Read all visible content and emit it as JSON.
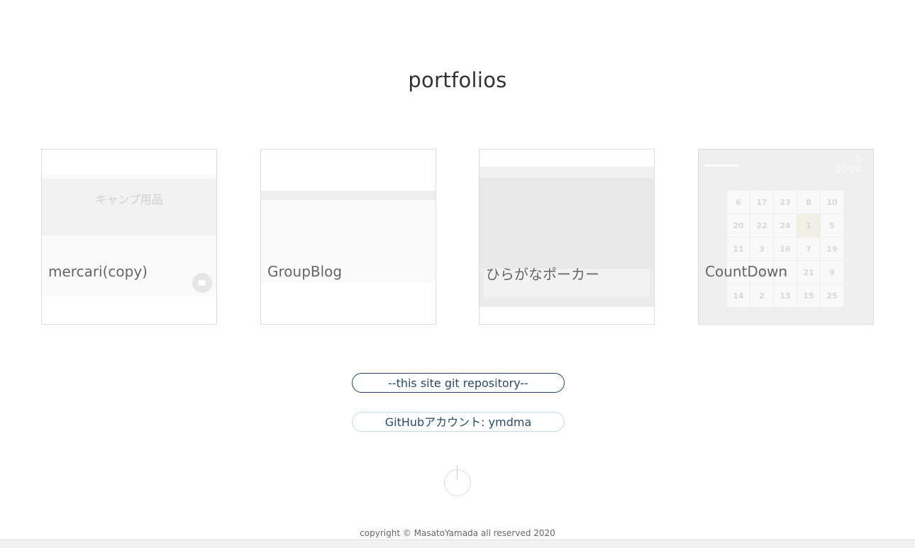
{
  "page": {
    "title": "portfolios"
  },
  "cards": [
    {
      "label": "mercari(copy)",
      "thumb_text": "キャンプ用品"
    },
    {
      "label": "GroupBlog"
    },
    {
      "label": "ひらがなポーカー"
    },
    {
      "label": "CountDown",
      "counter": "0",
      "timer": "00:00",
      "grid": [
        "6",
        "17",
        "23",
        "8",
        "10",
        "20",
        "22",
        "24",
        "1",
        "5",
        "11",
        "3",
        "16",
        "7",
        "19",
        "",
        "2",
        "2",
        "21",
        "9",
        "14",
        "2",
        "13",
        "15",
        "25"
      ]
    }
  ],
  "links": {
    "repo_label": "--this site git repository--",
    "github_label": "GitHubアカウント: ymdma"
  },
  "icons": {
    "scroll_top": "scroll-top-icon"
  },
  "footer": {
    "copyright": "copyright © MasatoYamada all reserved 2020"
  },
  "colors": {
    "accent": "#23466b",
    "text": "#333333"
  }
}
